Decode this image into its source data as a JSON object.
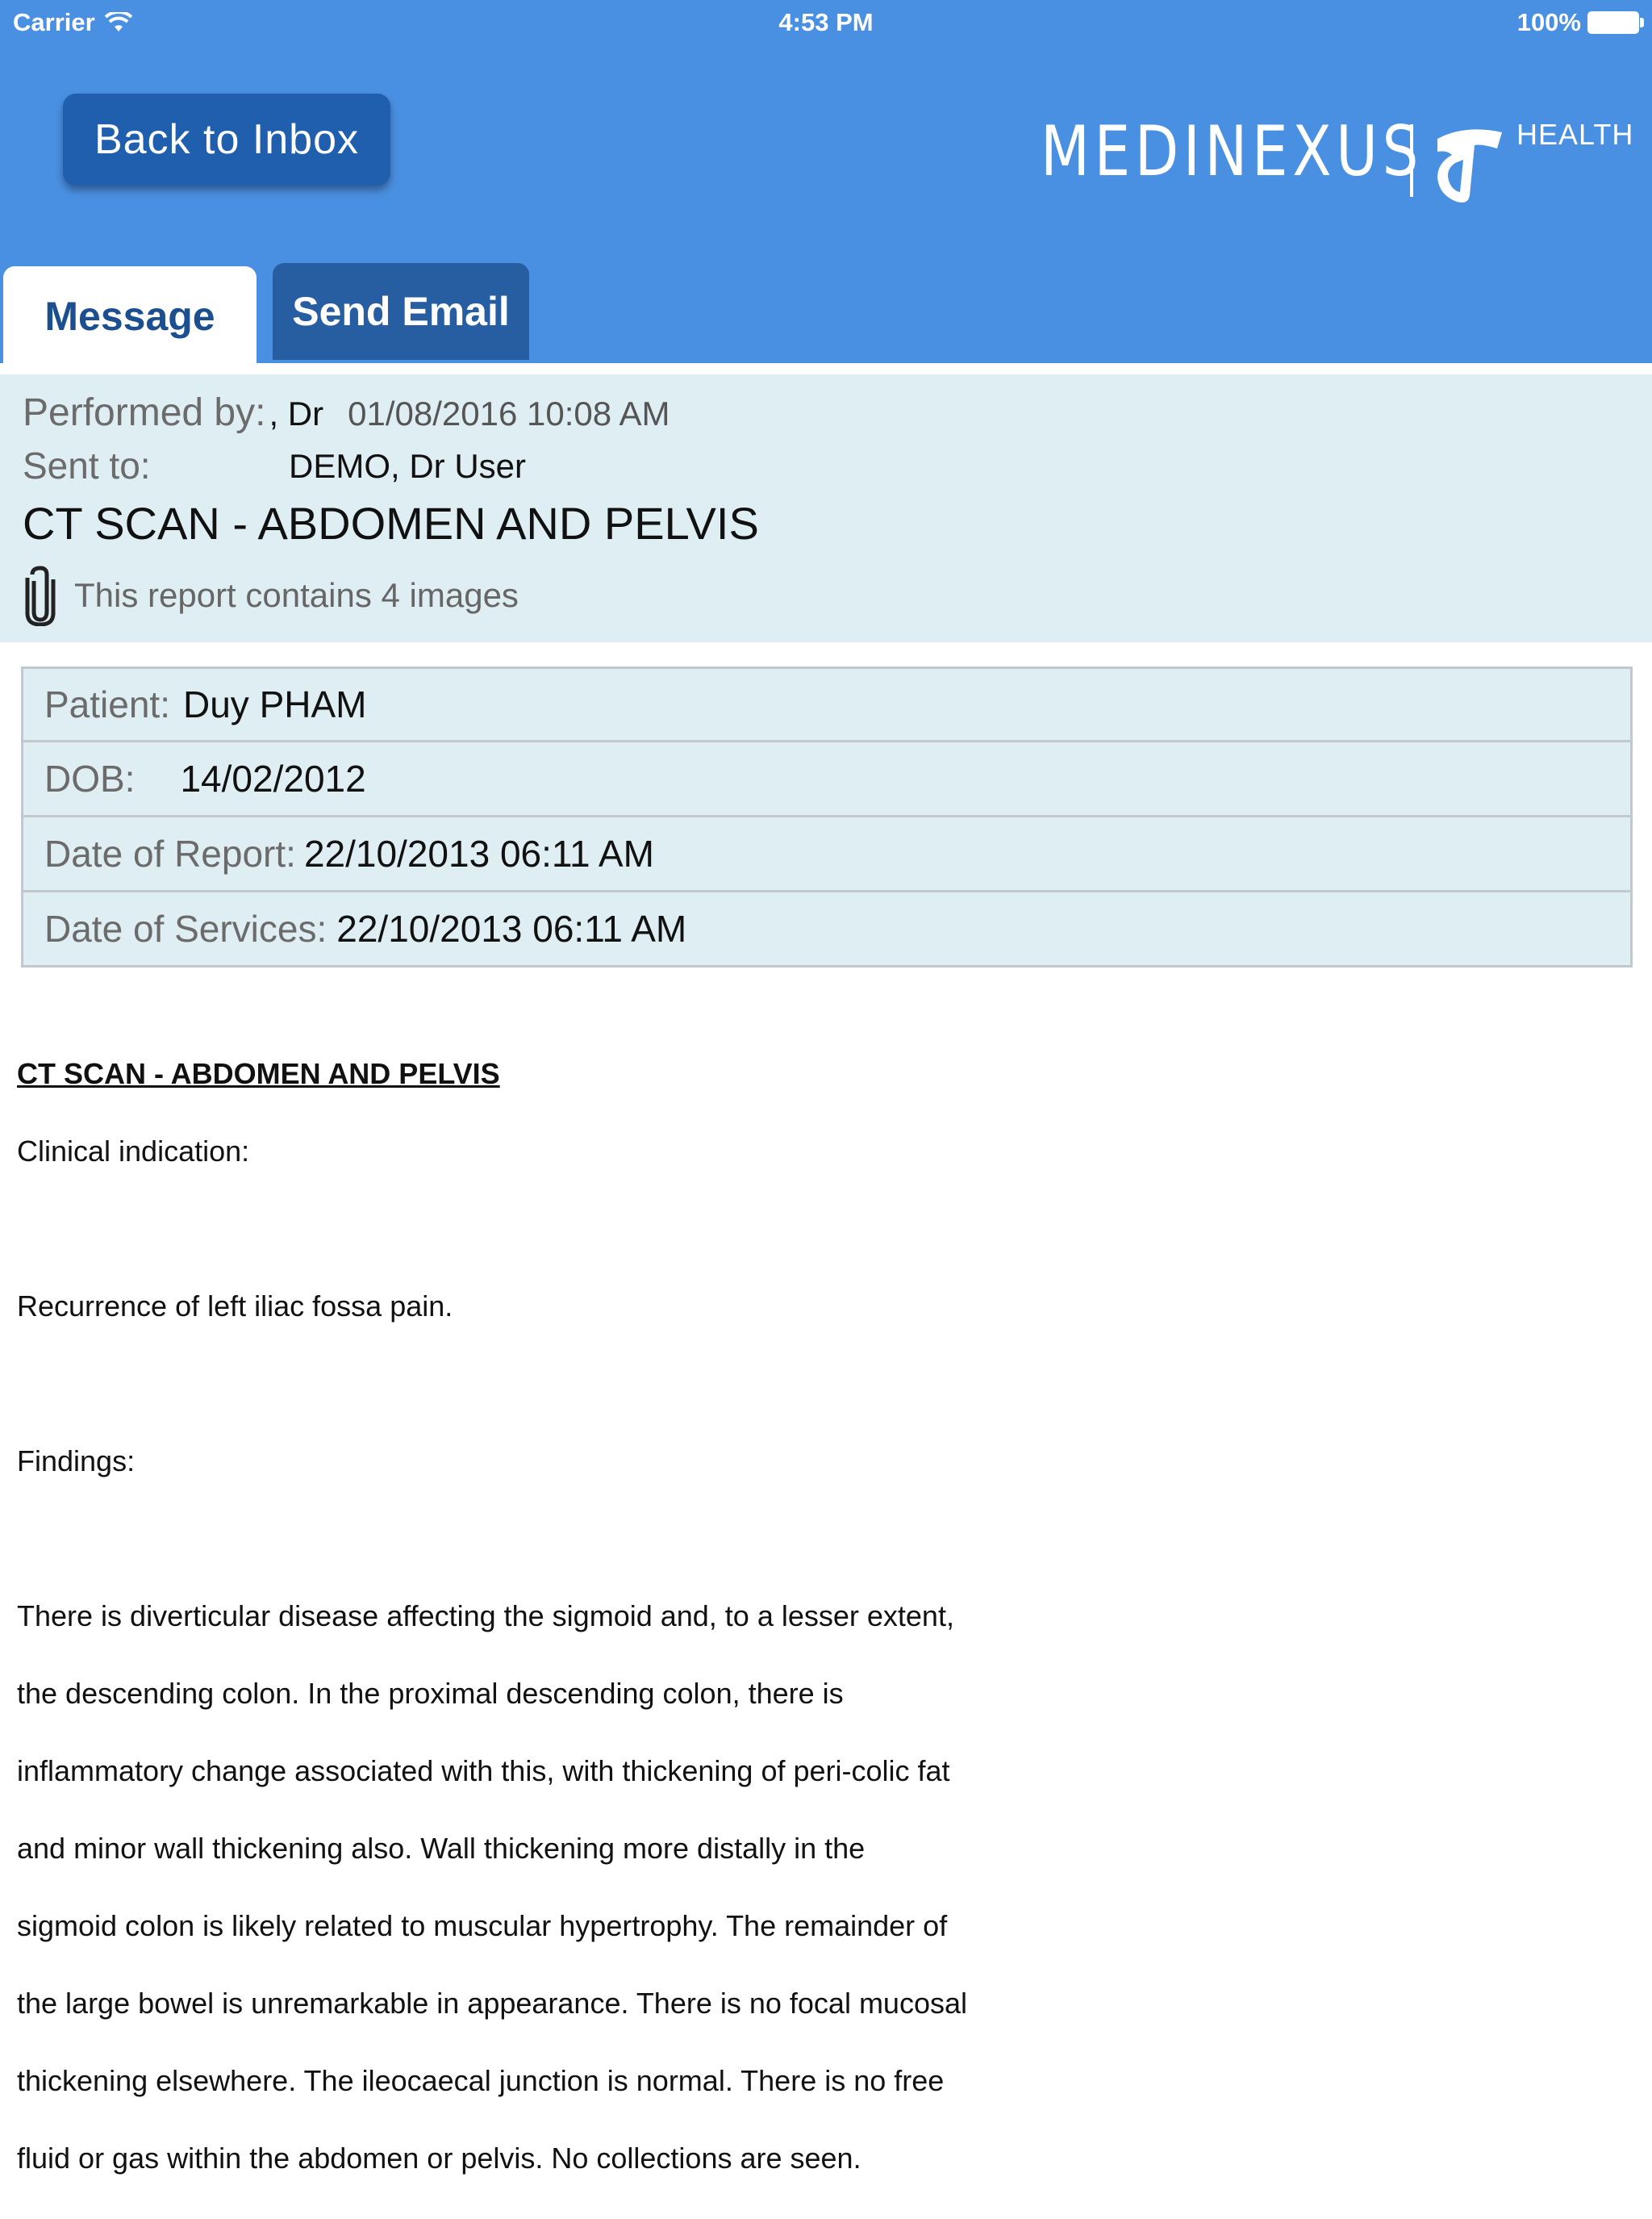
{
  "status_bar": {
    "carrier": "Carrier",
    "time": "4:53 PM",
    "battery": "100%"
  },
  "header": {
    "back_label": "Back to Inbox",
    "brand_name": "MEDINEXUS",
    "brand_suffix": "HEALTH"
  },
  "tabs": [
    {
      "label": "Message",
      "active": true
    },
    {
      "label": "Send Email",
      "active": false
    }
  ],
  "message": {
    "performed_label": "Performed by:",
    "performed_value": ", Dr",
    "performed_date": "01/08/2016 10:08 AM",
    "sent_label": "Sent to:",
    "sent_value": "DEMO, Dr User",
    "title": "CT SCAN - ABDOMEN AND PELVIS",
    "attachment_text": "This report contains 4 images"
  },
  "patient": {
    "rows": [
      {
        "label": "Patient:",
        "value": "Duy PHAM"
      },
      {
        "label": "DOB:",
        "value": "14/02/2012"
      },
      {
        "label": "Date of Report:",
        "value": "22/10/2013 06:11 AM"
      },
      {
        "label": "Date of Services:",
        "value": "22/10/2013 06:11 AM"
      }
    ]
  },
  "report": {
    "heading": "CT SCAN - ABDOMEN AND PELVIS",
    "clinical_label": "Clinical indication:",
    "clinical_text": "Recurrence of left iliac fossa pain.",
    "findings_label": "Findings:",
    "findings_lines": [
      "There is diverticular disease affecting the sigmoid and, to a lesser extent,",
      "the descending colon. In the proximal descending colon, there is",
      "inflammatory change associated with this, with thickening of peri-colic fat",
      "and minor wall thickening also. Wall thickening more distally in the",
      "sigmoid colon is likely related to muscular hypertrophy. The remainder of",
      "the large bowel is unremarkable in appearance. There is no focal mucosal",
      "thickening elsewhere. The ileocaecal junction is normal. There is no free",
      "fluid or gas within the abdomen or pelvis. No collections are seen."
    ]
  },
  "colors": {
    "header_blue": "#4a90e2",
    "button_blue": "#1f5fae",
    "tab_active_text": "#1c4f8f",
    "info_background": "#dfeef3"
  },
  "icons": {
    "wifi": "wifi-icon",
    "battery": "battery-icon",
    "brand_logo": "telstra-t-logo-icon",
    "attachment": "paperclip-icon"
  }
}
